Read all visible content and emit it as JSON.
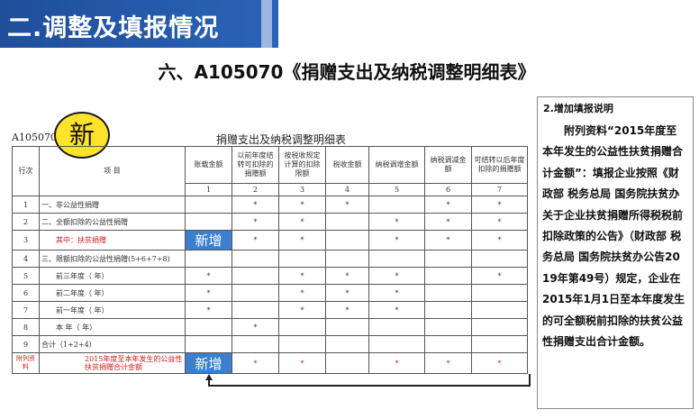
{
  "header": {
    "section_label": "二.调整及填报情况"
  },
  "slide_title": "六、A105070《捐赠支出及纳税调整明细表》",
  "form": {
    "code": "A105070",
    "badge": "新",
    "title": "捐赠支出及纳税调整明细表",
    "headers": {
      "row_no": "行次",
      "item": "项    目",
      "c1": "账载金额",
      "c2": "以前年度结转可扣除的捐赠额",
      "c3": "按税收规定计算的扣除限额",
      "c4": "税收金额",
      "c5": "纳税调增金额",
      "c6": "纳税调减金额",
      "c7": "可结转以后年度扣除的捐赠额"
    },
    "col_numbers": [
      "1",
      "2",
      "3",
      "4",
      "5",
      "6",
      "7"
    ],
    "star": "*",
    "new_label": "新增",
    "rows": [
      {
        "no": "1",
        "item": "一、非公益性捐赠"
      },
      {
        "no": "2",
        "item": "二、全额扣除的公益性捐赠"
      },
      {
        "no": "3",
        "item": "其中：扶贫捐赠"
      },
      {
        "no": "4",
        "item": "三、限额扣除的公益性捐赠(5+6+7+8)"
      },
      {
        "no": "5",
        "item": "前三年度（          年）"
      },
      {
        "no": "6",
        "item": "前二年度（          年）"
      },
      {
        "no": "7",
        "item": "前一年度（          年）"
      },
      {
        "no": "8",
        "item": "本    年（          年）"
      },
      {
        "no": "9",
        "item": "合计（1+2+4）"
      }
    ],
    "appendix": {
      "label": "附列资料",
      "item": "2015年度至本年发生的公益性扶贫捐赠合计金额"
    }
  },
  "note": {
    "heading": "2.增加填报说明",
    "body": "附列资料“2015年度至本年发生的公益性扶贫捐赠合计金额”：填报企业按照《财政部 税务总局 国务院扶贫办关于企业扶贫捐赠所得税税前扣除政策的公告》（财政部 税务总局 国务院扶贫办公告2019年第49号）规定，企业在2015年1月1日至本年度发生的可全额税前扣除的扶贫公益性捐赠支出合计金额。"
  },
  "colors": {
    "bar": "#1f4e9a",
    "badge": "#ffe22a",
    "new_cell": "#3c7fcf",
    "red_text": "#d21e1e"
  }
}
